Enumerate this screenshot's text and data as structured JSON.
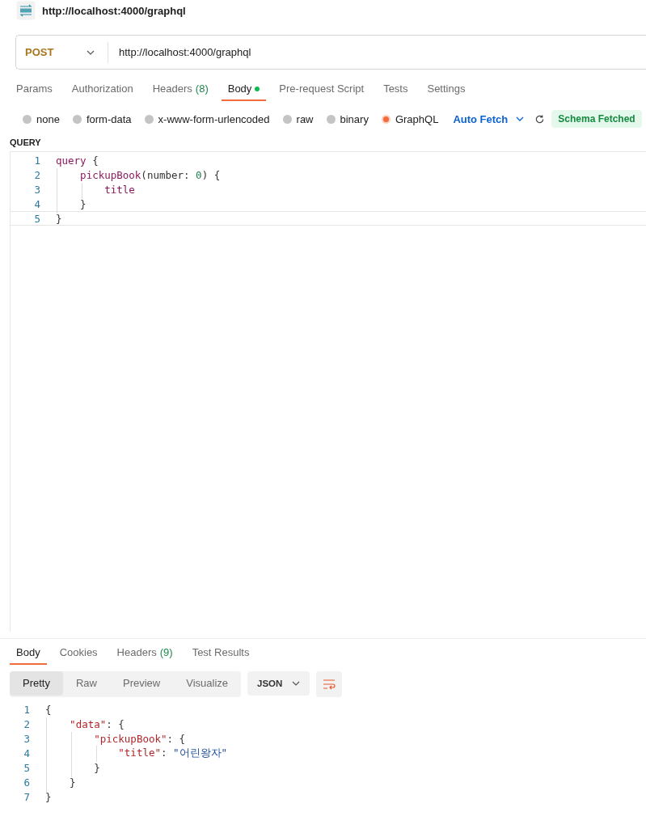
{
  "header": {
    "title": "http://localhost:4000/graphql"
  },
  "request": {
    "method": "POST",
    "url": "http://localhost:4000/graphql"
  },
  "request_tabs": [
    {
      "label": "Params",
      "selected": false
    },
    {
      "label": "Authorization",
      "selected": false
    },
    {
      "label": "Headers",
      "count": "(8)",
      "selected": false
    },
    {
      "label": "Body",
      "dot": true,
      "selected": true
    },
    {
      "label": "Pre-request Script",
      "selected": false
    },
    {
      "label": "Tests",
      "selected": false
    },
    {
      "label": "Settings",
      "selected": false
    }
  ],
  "body_types": [
    {
      "label": "none",
      "selected": false
    },
    {
      "label": "form-data",
      "selected": false
    },
    {
      "label": "x-www-form-urlencoded",
      "selected": false
    },
    {
      "label": "raw",
      "selected": false
    },
    {
      "label": "binary",
      "selected": false
    },
    {
      "label": "GraphQL",
      "selected": true
    }
  ],
  "auto_fetch": "Auto Fetch",
  "schema_status": "Schema Fetched",
  "query": {
    "label": "QUERY",
    "lines": [
      {
        "number": "1",
        "tokens": [
          {
            "text": "query",
            "kind": "keyword"
          },
          {
            "text": " {",
            "kind": "punct"
          }
        ]
      },
      {
        "number": "2",
        "tokens": [
          {
            "text": "    pickupBook",
            "kind": "keyword"
          },
          {
            "text": "(number: ",
            "kind": "punct"
          },
          {
            "text": "0",
            "kind": "number"
          },
          {
            "text": ") {",
            "kind": "punct"
          }
        ]
      },
      {
        "number": "3",
        "tokens": [
          {
            "text": "        title",
            "kind": "keyword"
          }
        ]
      },
      {
        "number": "4",
        "tokens": [
          {
            "text": "    }",
            "kind": "punct"
          }
        ]
      },
      {
        "number": "5",
        "current": true,
        "tokens": [
          {
            "text": "}",
            "kind": "punct"
          }
        ]
      }
    ]
  },
  "response_tabs": [
    {
      "label": "Body",
      "selected": true
    },
    {
      "label": "Cookies",
      "selected": false
    },
    {
      "label": "Headers",
      "count": "(9)",
      "selected": false
    },
    {
      "label": "Test Results",
      "selected": false
    }
  ],
  "view_modes": [
    {
      "label": "Pretty",
      "selected": true
    },
    {
      "label": "Raw",
      "selected": false
    },
    {
      "label": "Preview",
      "selected": false
    },
    {
      "label": "Visualize",
      "selected": false
    }
  ],
  "format": "JSON",
  "response": {
    "lines": [
      {
        "number": "1",
        "tokens": [
          {
            "text": "{",
            "kind": "punct"
          }
        ]
      },
      {
        "number": "2",
        "tokens": [
          {
            "text": "    \"data\"",
            "kind": "key"
          },
          {
            "text": ": {",
            "kind": "punct"
          }
        ]
      },
      {
        "number": "3",
        "tokens": [
          {
            "text": "        \"pickupBook\"",
            "kind": "key"
          },
          {
            "text": ": {",
            "kind": "punct"
          }
        ]
      },
      {
        "number": "4",
        "tokens": [
          {
            "text": "            \"title\"",
            "kind": "key"
          },
          {
            "text": ": ",
            "kind": "punct"
          },
          {
            "text": "\"어린왕자\"",
            "kind": "string"
          }
        ]
      },
      {
        "number": "5",
        "tokens": [
          {
            "text": "        }",
            "kind": "punct"
          }
        ]
      },
      {
        "number": "6",
        "tokens": [
          {
            "text": "    }",
            "kind": "punct"
          }
        ]
      },
      {
        "number": "7",
        "tokens": [
          {
            "text": "}",
            "kind": "punct"
          }
        ]
      }
    ]
  }
}
